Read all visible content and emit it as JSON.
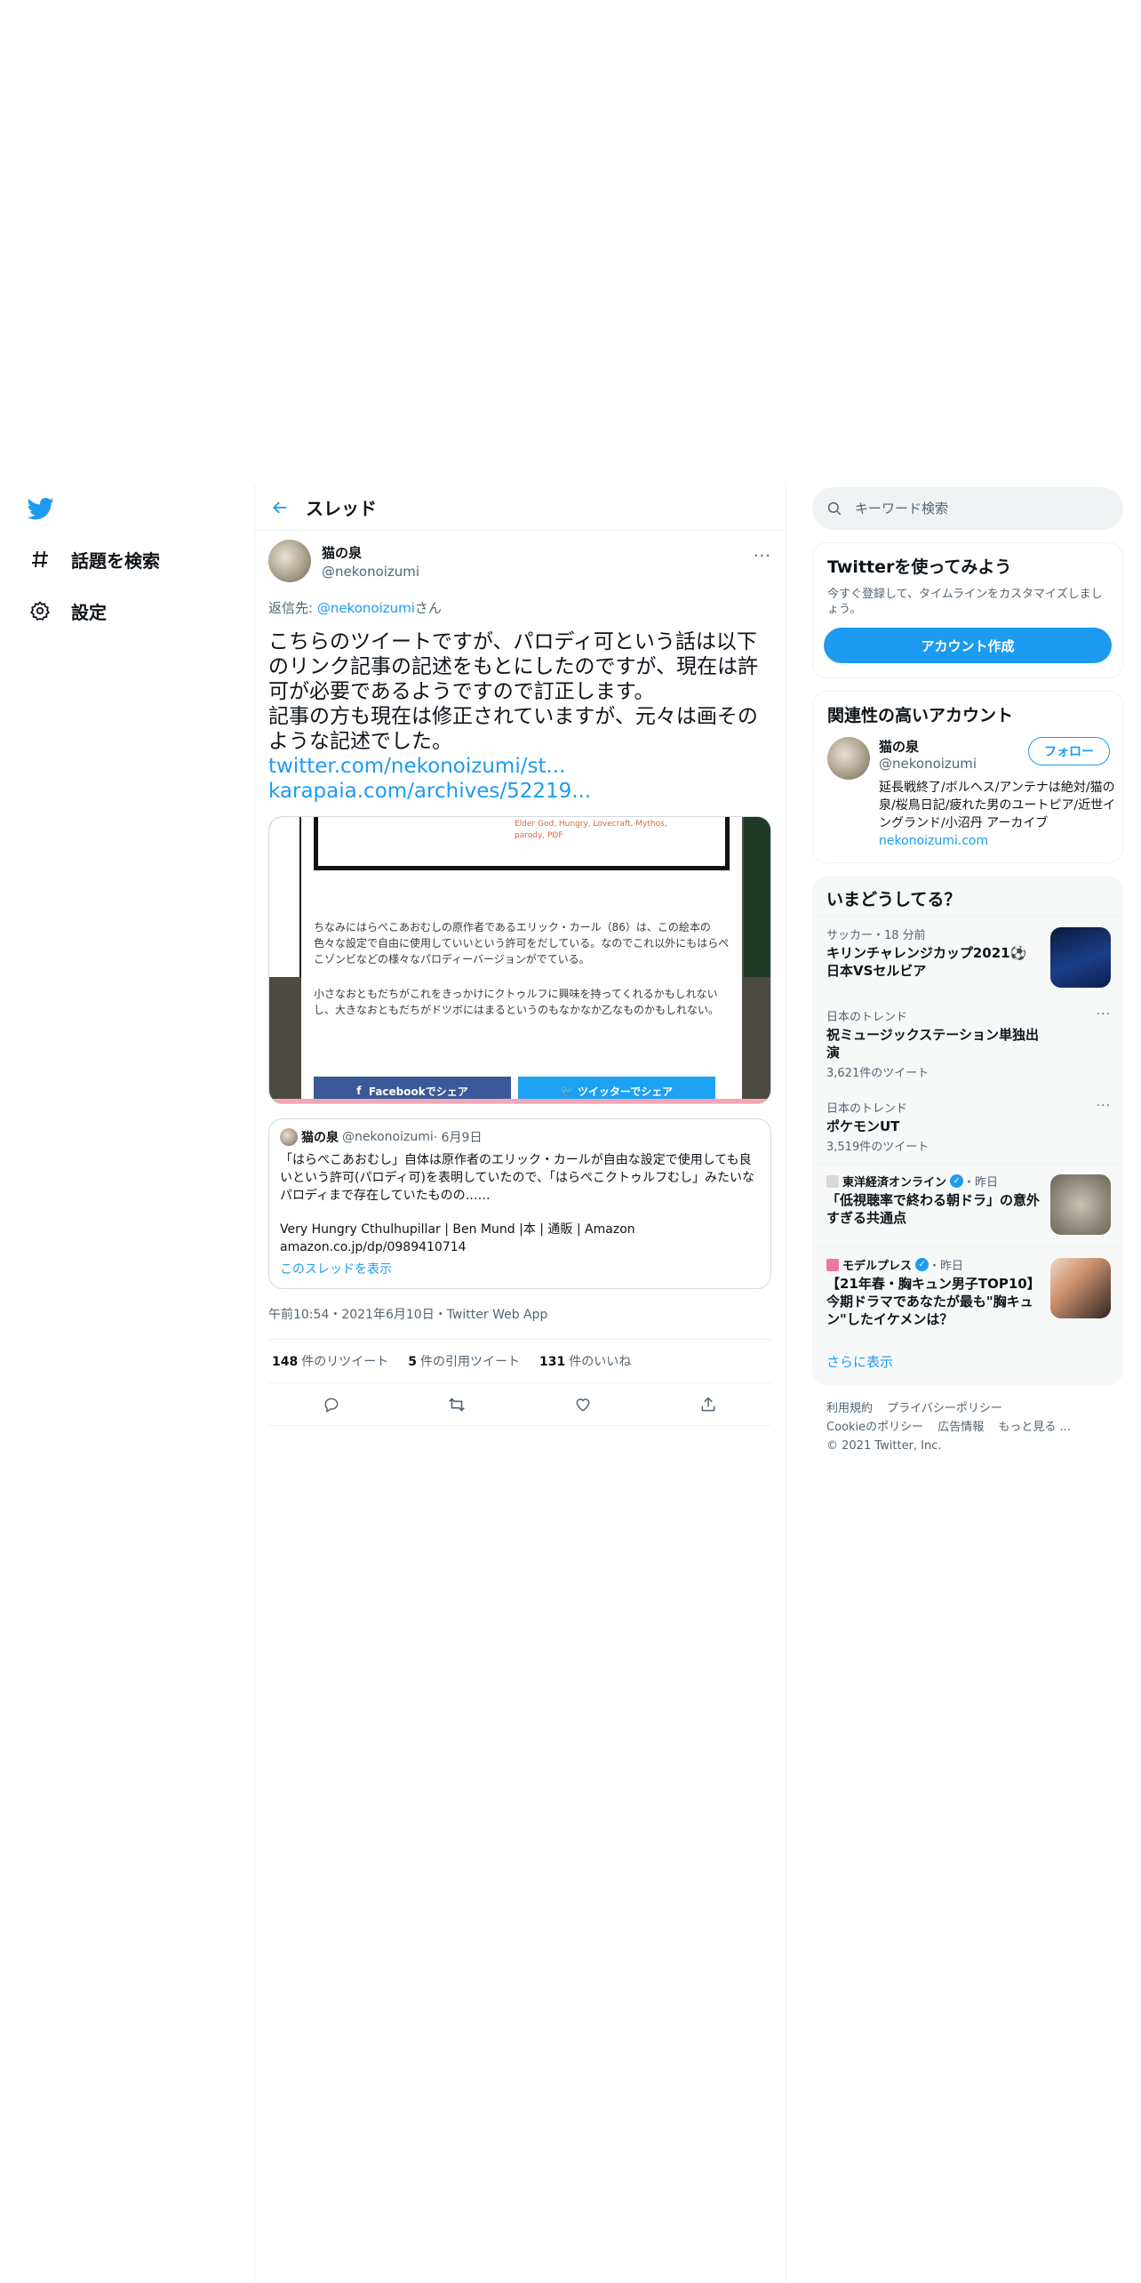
{
  "nav": {
    "explore_label": "話題を検索",
    "settings_label": "設定"
  },
  "header": {
    "title": "スレッド"
  },
  "tweet": {
    "author_name": "猫の泉",
    "author_handle": "@nekonoizumi",
    "reply_prefix": "返信先: ",
    "reply_handle": "@nekonoizumi",
    "reply_suffix": "さん",
    "text": "こちらのツイートですが、パロディ可という話は以下のリンク記事の記述をもとにしたのですが、現在は許可が必要であるようですので訂正します。\n記事の方も現在は修正されていますが、元々は画そのような記述でした。",
    "link1": "twitter.com/nekonoizumi/st...",
    "link2": "karapaia.com/archives/52219...",
    "media": {
      "tags": "Elder God, Hungry, Lovecraft, Mythos,\nparody, PDF",
      "para1": "ちなみにはらぺこあおむしの原作者であるエリック・カール（86）は、この絵本の色々な設定で自由に使用していいという許可をだしている。なのでこれ以外にもはらぺこゾンビなどの様々なパロディーバージョンがでている。",
      "para2": "小さなおともだちがこれをきっかけにクトゥルフに興味を持ってくれるかもしれないし、大きなおともだちがドツボにはまるというのもなかなか乙なものかもしれない。",
      "fb_label": "Facebookでシェア",
      "tw_label": "ツイッターでシェア"
    },
    "quote": {
      "author_name": "猫の泉",
      "author_handle": "@nekonoizumi",
      "date": " · 6月9日",
      "text": "「はらぺこあおむし」自体は原作者のエリック・カールが自由な設定で使用しても良いという許可(パロディ可)を表明していたので、「はらぺこクトゥルフむし」みたいなパロディまで存在していたものの……",
      "link_title": "Very Hungry Cthulhupillar | Ben Mund |本 | 通販 | Amazon",
      "link_url": "amazon.co.jp/dp/0989410714",
      "show_thread": "このスレッドを表示"
    },
    "timestamp": "午前10:54・2021年6月10日・Twitter Web App",
    "retweets": "148",
    "retweets_label": "件のリツイート",
    "quotes": "5",
    "quotes_label": "件の引用ツイート",
    "likes": "131",
    "likes_label": "件のいいね"
  },
  "sidebar": {
    "search_placeholder": "キーワード検索",
    "signup": {
      "title": "Twitterを使ってみよう",
      "subtitle": "今すぐ登録して、タイムラインをカスタマイズしましょう。",
      "button": "アカウント作成"
    },
    "relevant": {
      "title": "関連性の高いアカウント",
      "name": "猫の泉",
      "handle": "@nekonoizumi",
      "follow": "フォロー",
      "bio": "延長戦終了/ボルヘス/アンテナは絶対/猫の泉/桜鳥日記/疲れた男のユートピア/近世イングランド/小沼丹 アーカイブ ",
      "bio_link": "nekonoizumi.com"
    },
    "trends": {
      "title": "いまどうしてる？",
      "items": [
        {
          "context": "サッカー・18 分前",
          "title": "キリンチャレンジカップ2021⚽日本VSセルビア"
        },
        {
          "context": "日本のトレンド",
          "title": "祝ミュージックステーション単独出演",
          "count": "3,621件のツイート"
        },
        {
          "context": "日本のトレンド",
          "title": "ポケモンUT",
          "count": "3,519件のツイート"
        },
        {
          "publisher": "東洋経済オンライン",
          "time": "・昨日",
          "title": "「低視聴率で終わる朝ドラ」の意外すぎる共通点"
        },
        {
          "publisher": "モデルプレス",
          "time": "・昨日",
          "title": "【21年春・胸キュン男子TOP10】今期ドラマであなたが最も\"胸キュン\"したイケメンは？"
        }
      ],
      "show_more": "さらに表示"
    },
    "footer": {
      "terms": "利用規約",
      "privacy": "プライバシーポリシー",
      "cookies": "Cookieのポリシー",
      "ads": "広告情報",
      "more": "もっと見る ...",
      "copyright": "© 2021 Twitter, Inc."
    }
  },
  "colors": {
    "accent": "#1d9bf0",
    "text": "#0f1419",
    "muted": "#536471",
    "border": "#eff3f4"
  }
}
